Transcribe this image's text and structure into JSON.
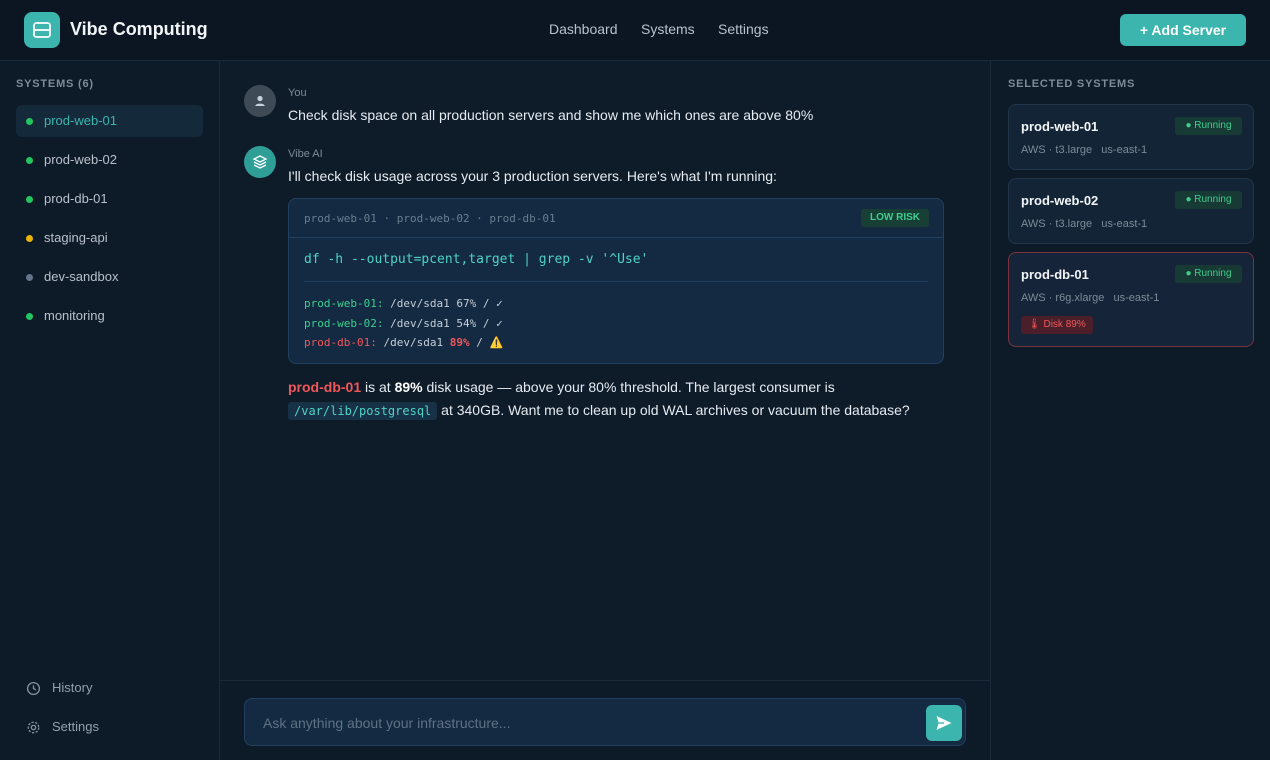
{
  "app": {
    "title": "Vibe Computing"
  },
  "header": {
    "nav": [
      "Dashboard",
      "Systems",
      "Settings"
    ],
    "add_button": "+ Add Server"
  },
  "sidebar": {
    "title": "SYSTEMS (6)",
    "items": [
      {
        "label": "prod-web-01",
        "status_color": "#22c55e",
        "active": true
      },
      {
        "label": "prod-web-02",
        "status_color": "#22c55e"
      },
      {
        "label": "prod-db-01",
        "status_color": "#22c55e"
      },
      {
        "label": "staging-api",
        "status_color": "#eab308"
      },
      {
        "label": "dev-sandbox",
        "status_color": "#64748b"
      },
      {
        "label": "monitoring",
        "status_color": "#22c55e"
      }
    ],
    "footer": [
      {
        "label": "History",
        "icon": "history-icon"
      },
      {
        "label": "Settings",
        "icon": "gear-icon"
      }
    ]
  },
  "chat": {
    "user": {
      "name": "You",
      "text": "Check disk space on all production servers and show me which ones are above 80%"
    },
    "ai": {
      "name": "Vibe AI",
      "text": "I'll check disk usage across your 3 production servers. Here's what I'm running:",
      "code": {
        "targets": "prod-web-01 · prod-web-02 · prod-db-01",
        "risk": "LOW RISK",
        "command": "df -h --output=pcent,target | grep -v '^Use'",
        "output": [
          {
            "host": "prod-web-01:",
            "device": "/dev/sda1",
            "pct": "67%",
            "mount": "/",
            "mark": "✓",
            "alert": false
          },
          {
            "host": "prod-web-02:",
            "device": "/dev/sda1",
            "pct": "54%",
            "mount": "/",
            "mark": "✓",
            "alert": false
          },
          {
            "host": "prod-db-01:",
            "device": "/dev/sda1",
            "pct": "89%",
            "mount": "/",
            "mark": "⚠️",
            "alert": true
          }
        ]
      },
      "summary": {
        "server": "prod-db-01",
        "t1": " is at ",
        "pct": "89%",
        "t2": " disk usage — above your 80% threshold. The largest consumer is",
        "path": "/var/lib/postgresql",
        "t3": " at 340GB. Want me to clean up old WAL archives or vacuum the database?"
      }
    },
    "input_placeholder": "Ask anything about your infrastructure..."
  },
  "selected": {
    "title": "SELECTED SYSTEMS",
    "cards": [
      {
        "name": "prod-web-01",
        "status": "● Running",
        "provider": "AWS · t3.large",
        "region": "us-east-1"
      },
      {
        "name": "prod-web-02",
        "status": "● Running",
        "provider": "AWS · t3.large",
        "region": "us-east-1"
      },
      {
        "name": "prod-db-01",
        "status": "● Running",
        "provider": "AWS · r6g.xlarge",
        "region": "us-east-1",
        "alert": "🌡 Disk 89%"
      }
    ]
  }
}
